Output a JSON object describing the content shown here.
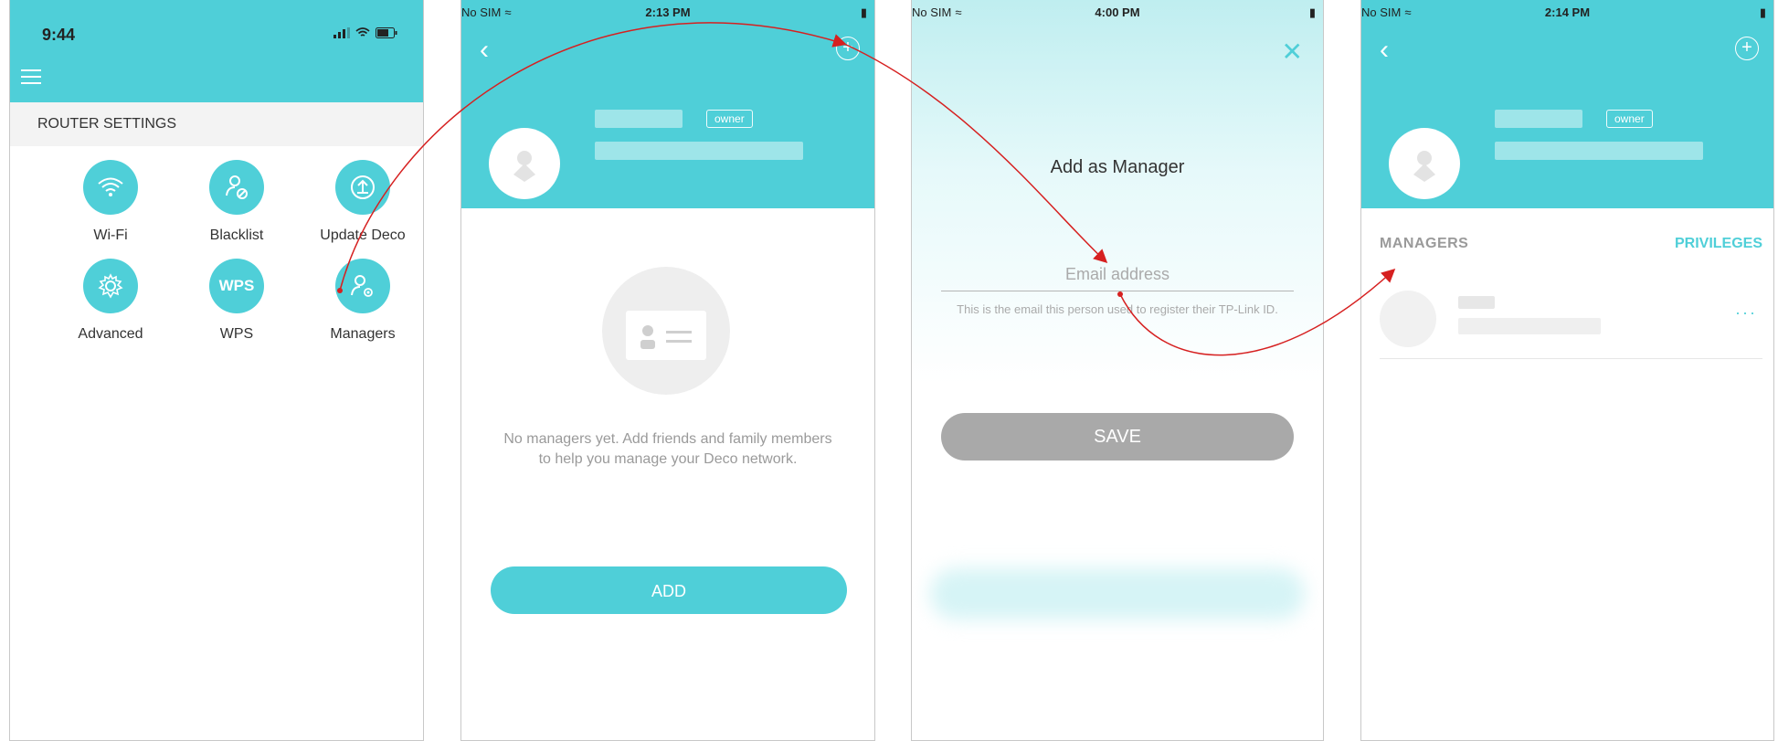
{
  "colors": {
    "accent": "#4fcfd8",
    "arrow": "#d62020",
    "save_disabled": "#a9a9a9"
  },
  "screen1": {
    "time": "9:44",
    "section_title": "ROUTER SETTINGS",
    "tiles": [
      {
        "label": "Wi-Fi",
        "icon": "wifi-icon"
      },
      {
        "label": "Blacklist",
        "icon": "blacklist-icon"
      },
      {
        "label": "Update Deco",
        "icon": "upload-icon"
      },
      {
        "label": "Advanced",
        "icon": "gear-icon"
      },
      {
        "label": "WPS",
        "icon": "wps-icon",
        "text": "WPS"
      },
      {
        "label": "Managers",
        "icon": "managers-icon"
      }
    ]
  },
  "screen2": {
    "status": {
      "carrier": "No SIM",
      "time": "2:13 PM"
    },
    "owner_badge": "owner",
    "empty_text": "No managers yet. Add friends and family members to help you manage your Deco network.",
    "add_button": "ADD"
  },
  "screen3": {
    "status": {
      "carrier": "No SIM",
      "time": "4:00 PM"
    },
    "title": "Add as Manager",
    "email_placeholder": "Email address",
    "hint": "This is the email this person used to register their TP-Link ID.",
    "save_button": "SAVE"
  },
  "screen4": {
    "status": {
      "carrier": "No SIM",
      "time": "2:14 PM"
    },
    "owner_badge": "owner",
    "managers_header": "MANAGERS",
    "privileges": "PRIVILEGES",
    "more": "···"
  }
}
